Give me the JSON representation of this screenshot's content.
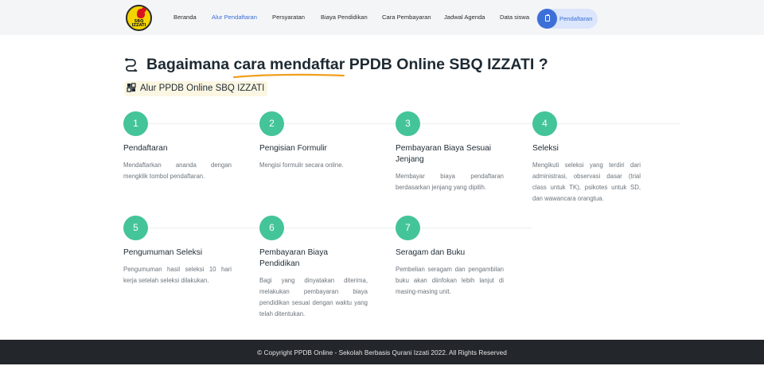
{
  "brand": {
    "logo_text_top": "SBQ",
    "logo_text_bottom": "IZZATI"
  },
  "nav": {
    "items": [
      "Beranda",
      "Alur Pendaftaran",
      "Persyaratan",
      "Biaya Pendidikan",
      "Cara Pembayaran",
      "Jadwal Agenda",
      "Data siswa"
    ],
    "active": "Alur Pendaftaran",
    "cta_label": "Pendaftaran"
  },
  "heading": {
    "pre": "Bagaimana ",
    "highlight": "cara mendaftar",
    "post": " PPDB Online SBQ IZZATI ?"
  },
  "subheading": "Alur PPDB Online SBQ IZZATI",
  "steps": [
    {
      "number": "1",
      "title": "Pendaftaran",
      "desc": "Mendaftarkan ananda dengan mengklik tombol pendaftaran."
    },
    {
      "number": "2",
      "title": "Pengisian Formulir",
      "desc": "Mengisi formulir secara online."
    },
    {
      "number": "3",
      "title": "Pembayaran Biaya Sesuai Jenjang",
      "desc": "Membayar biaya pendaftaran berdasarkan jenjang yang dipilih."
    },
    {
      "number": "4",
      "title": "Seleksi",
      "desc": "Mengikuti seleksi yang terdiri dari administrasi, observasi dasar (trial class untuk TK), psikotes untuk SD, dan wawancara orangtua."
    },
    {
      "number": "5",
      "title": "Pengumuman Seleksi",
      "desc": "Pengumuman hasil seleksi 10 hari kerja setelah seleksi dilakukan."
    },
    {
      "number": "6",
      "title": "Pembayaran Biaya Pendidikan",
      "desc": "Bagi yang dinyatakan diterima, melakukan pembayaran biaya pendidikan sesuai dengan waktu yang telah ditentukan."
    },
    {
      "number": "7",
      "title": "Seragam dan Buku",
      "desc": "Pembelian seragam dan pengambilan buku akan diinfokan lebih lanjut di masing-masing unit."
    }
  ],
  "footer": {
    "text": "© Copyright PPDB Online - Sekolah Berbasis Qurani Izzati 2022. All Rights Reserved"
  },
  "colors": {
    "accent": "#3b6fd6",
    "step": "#44c499",
    "underline": "#f0a01e",
    "footer_bg": "#23262b"
  }
}
